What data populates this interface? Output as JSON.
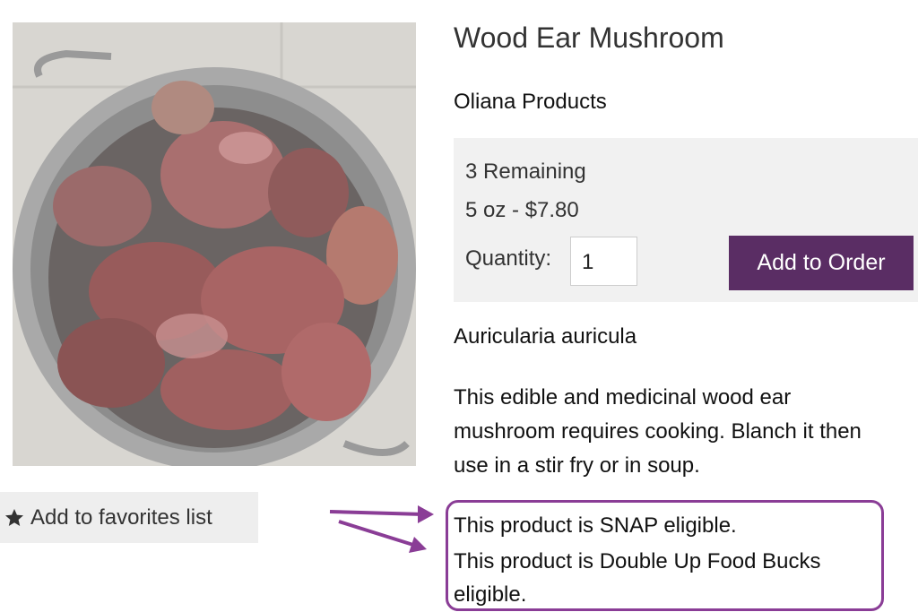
{
  "product": {
    "title": "Wood Ear Mushroom",
    "vendor": "Oliana Products",
    "scientific_name": "Auricularia auricula",
    "description_lines": [
      "This edible and medicinal wood ear",
      "mushroom requires cooking. Blanch it then",
      "use in a stir fry or in soup."
    ],
    "image": {
      "depicts": "wood ear mushrooms in a metal colander",
      "icon": "product-photo"
    }
  },
  "buybox": {
    "remaining": "3 Remaining",
    "price": "5 oz - $7.80",
    "quantity_label": "Quantity:",
    "quantity_value": "1",
    "add_button": "Add to Order",
    "button_color": "#5a2d64"
  },
  "favorites": {
    "label": "Add to favorites list",
    "icon": "star-icon"
  },
  "eligibility": {
    "snap": "This product is SNAP eligible.",
    "dufb_line1": "This product is Double Up Food Bucks",
    "dufb_line2": "eligible.",
    "highlight_color": "#8a3d96"
  }
}
